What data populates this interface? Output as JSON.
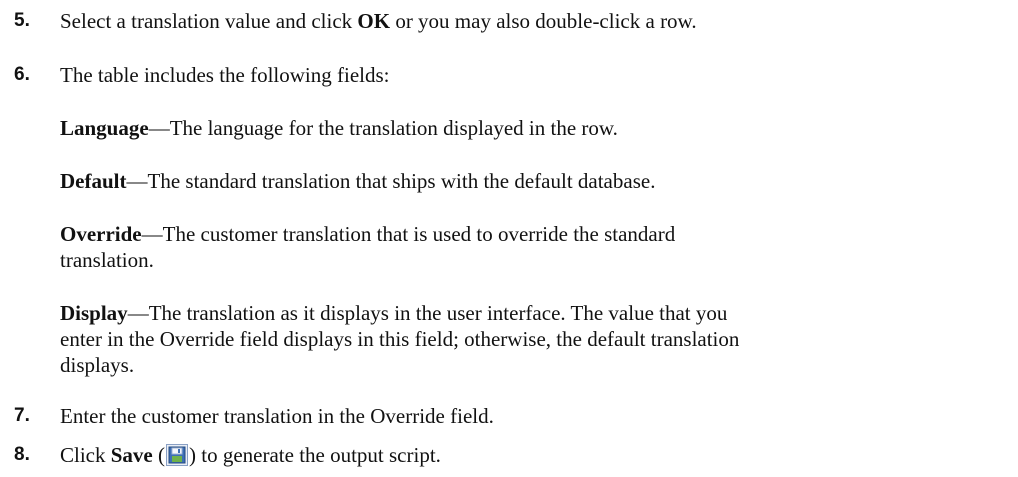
{
  "steps": [
    {
      "number": "5.",
      "pre": "Select a translation value and click ",
      "bold": "OK",
      "post": " or you may also double-click a row."
    },
    {
      "number": "6.",
      "text": "The table includes the following fields:"
    },
    {
      "number": "7.",
      "text": "Enter the customer translation in the Override field."
    },
    {
      "number": "8.",
      "pre": "Click ",
      "bold": "Save",
      "open": " (",
      "close": ") to generate the output script."
    }
  ],
  "fields": [
    {
      "term": "Language",
      "desc": "—The language for the translation displayed in the row."
    },
    {
      "term": "Default",
      "desc": "—The standard translation that ships with the default database."
    },
    {
      "term": "Override",
      "desc_line1": "—The customer translation that is used to override the standard",
      "desc_line2": "translation."
    },
    {
      "term": "Display",
      "desc_line1": "—The translation as it displays in the user interface. The value that you",
      "desc_line2": "enter in the Override field displays in this field; otherwise, the default translation",
      "desc_line3": "displays."
    }
  ],
  "icons": {
    "save": "save-icon"
  }
}
